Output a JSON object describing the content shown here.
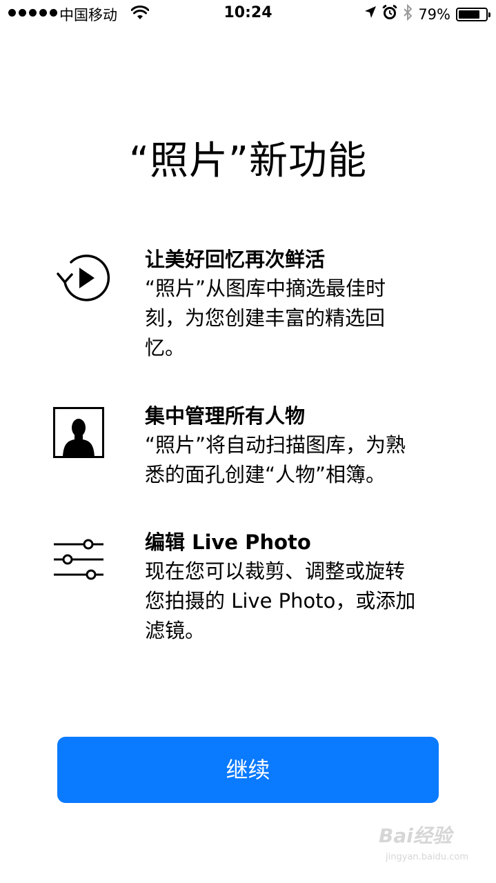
{
  "status_bar": {
    "carrier": "中国移动",
    "time": "10:24",
    "battery_percent": "79%",
    "battery_level": 0.79,
    "icons": [
      "signal-icon",
      "wifi-icon",
      "location-icon",
      "alarm-icon",
      "bluetooth-icon",
      "battery-icon"
    ]
  },
  "page": {
    "title": "“照片”新功能"
  },
  "features": [
    {
      "icon": "memories-play-icon",
      "title": "让美好回忆再次鲜活",
      "desc_lines": [
        "“照片”从图库中摘选最佳时",
        "刻，为您创建丰富的精选回",
        "忆。"
      ]
    },
    {
      "icon": "people-portrait-icon",
      "title": "集中管理所有人物",
      "desc_lines": [
        "“照片”将自动扫描图库，为熟",
        "悉的面孔创建“人物”相簿。"
      ]
    },
    {
      "icon": "adjust-sliders-icon",
      "title": "编辑 Live Photo",
      "desc_lines": [
        "现在您可以裁剪、调整或旋转",
        "您拍摄的 Live Photo，或添加",
        "滤镜。"
      ]
    }
  ],
  "continue_button": {
    "label": "继续",
    "color": "#0a7aff"
  },
  "watermark": {
    "main": "Bai经验",
    "sub": "jingyan.baidu.com"
  }
}
